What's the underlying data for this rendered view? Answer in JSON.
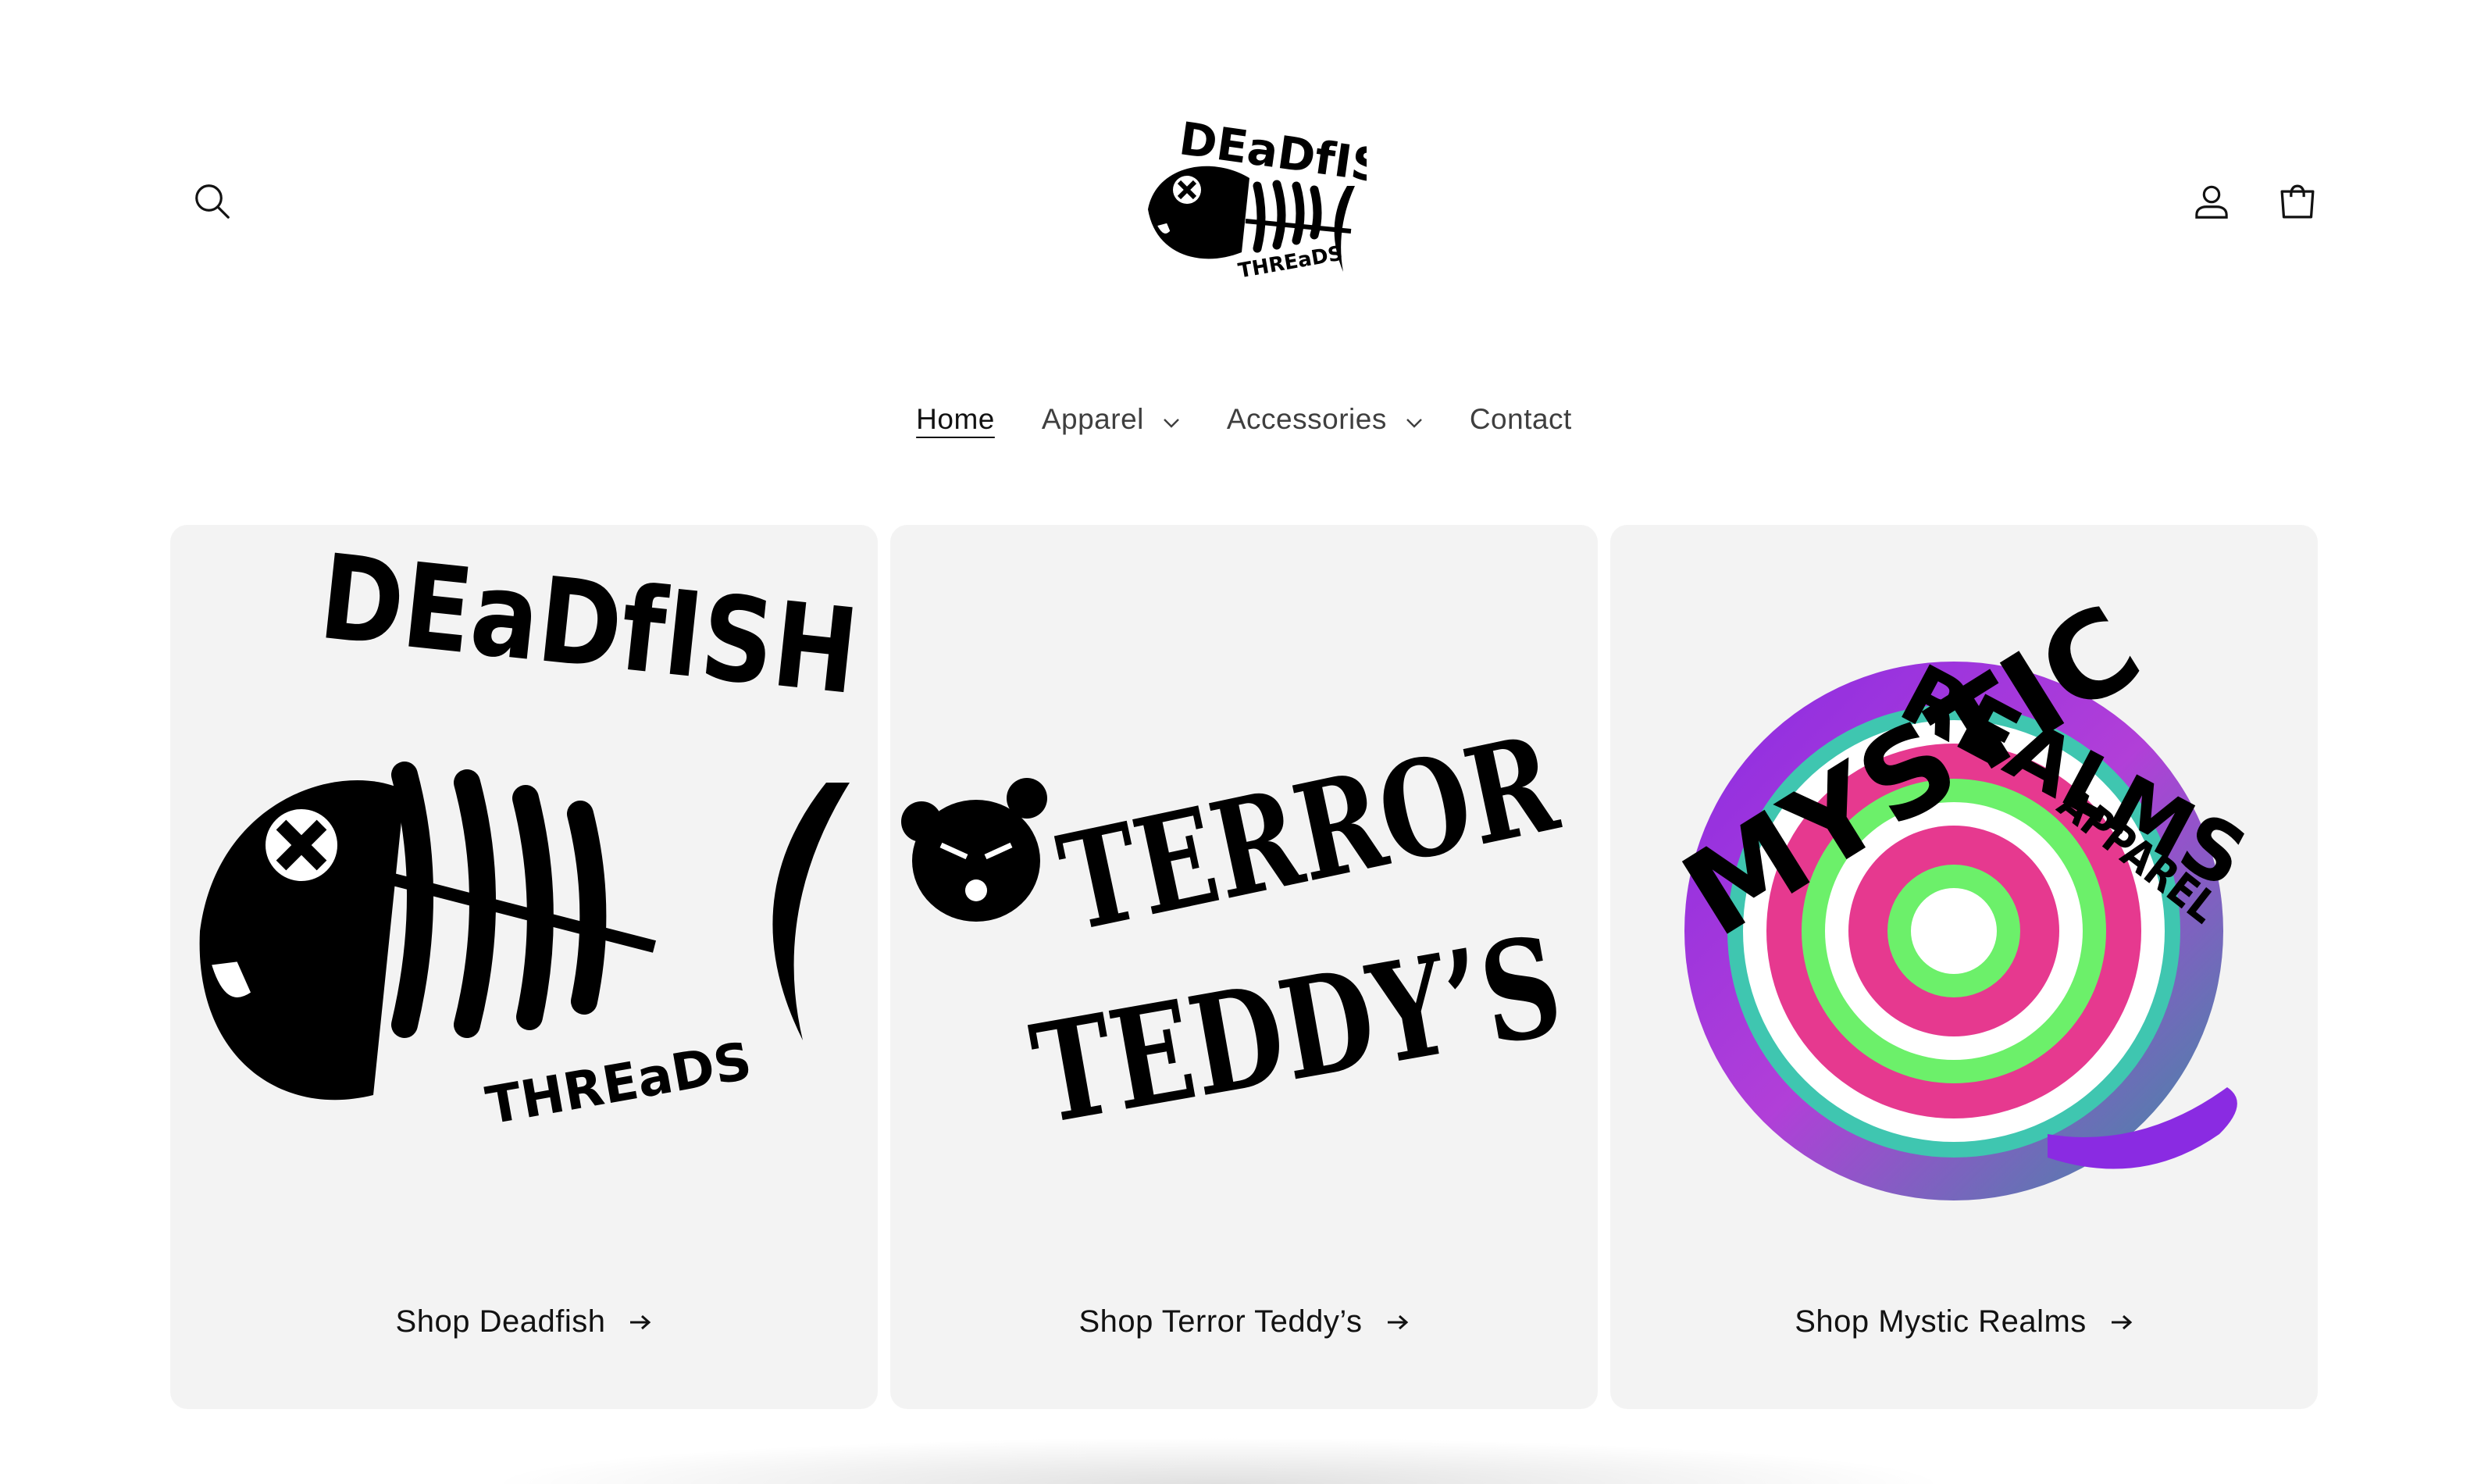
{
  "header": {
    "logo_text_top": "DEaDfISH",
    "logo_text_bottom": "THREaDS",
    "search_icon": "search-icon",
    "account_icon": "user-icon",
    "cart_icon": "bag-icon"
  },
  "nav": {
    "items": [
      {
        "label": "Home",
        "active": true
      },
      {
        "label": "Apparel",
        "has_dropdown": true
      },
      {
        "label": "Accessories",
        "has_dropdown": true
      },
      {
        "label": "Contact"
      }
    ]
  },
  "collections": [
    {
      "title": "Shop Deadfish",
      "brand_text_top": "DEaDfISH",
      "brand_text_bottom": "THREaDS"
    },
    {
      "title": "Shop Terror Teddy’s",
      "brand_text_top": "TERROR",
      "brand_text_bottom": "TEDDY’S"
    },
    {
      "title": "Shop Mystic Realms",
      "brand_text_top": "MYSTIC",
      "brand_text_middle": "REALMS",
      "brand_text_bottom": "APPAREL"
    }
  ],
  "colors": {
    "card_bg": "#f3f3f3",
    "text": "#121212",
    "swirl_purple": "#8a2be2",
    "swirl_pink": "#e6398f",
    "swirl_green": "#6cf06a",
    "swirl_teal": "#3a8fa0"
  }
}
